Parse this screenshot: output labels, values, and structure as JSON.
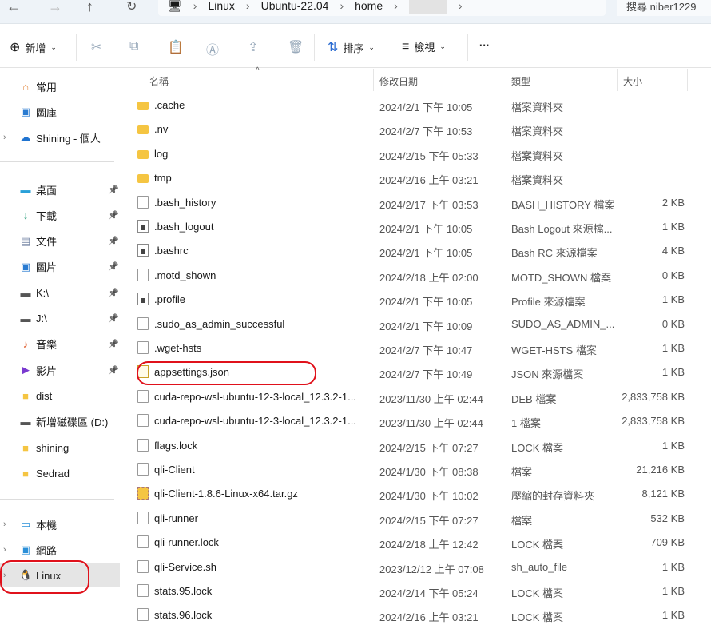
{
  "address": {
    "segments": [
      "Linux",
      "Ubuntu-22.04",
      "home"
    ],
    "search_placeholder": "搜尋 niber1229"
  },
  "toolbar": {
    "new": "新增",
    "sort": "排序",
    "view": "檢視",
    "more": "···"
  },
  "sidebar": {
    "top": [
      {
        "label": "常用",
        "icon": "home-icon"
      },
      {
        "label": "圖庫",
        "icon": "gallery-icon"
      },
      {
        "label": "Shining - 個人",
        "icon": "onedrive-icon"
      }
    ],
    "pinned": [
      {
        "label": "桌面",
        "icon": "desktop-icon"
      },
      {
        "label": "下載",
        "icon": "download-icon"
      },
      {
        "label": "文件",
        "icon": "documents-icon"
      },
      {
        "label": "圖片",
        "icon": "pictures-icon"
      },
      {
        "label": "K:\\",
        "icon": "network-drive-icon"
      },
      {
        "label": "J:\\",
        "icon": "network-drive-icon"
      },
      {
        "label": "音樂",
        "icon": "music-icon"
      },
      {
        "label": "影片",
        "icon": "video-icon"
      },
      {
        "label": "dist",
        "icon": "folder-icon"
      },
      {
        "label": "新增磁碟區 (D:)",
        "icon": "drive-icon"
      },
      {
        "label": "shining",
        "icon": "folder-icon"
      },
      {
        "label": "Sedrad",
        "icon": "folder-icon"
      }
    ],
    "bottom": [
      {
        "label": "本機",
        "icon": "pc-icon"
      },
      {
        "label": "網路",
        "icon": "network-icon"
      },
      {
        "label": "Linux",
        "icon": "linux-icon",
        "selected": true
      }
    ]
  },
  "columns": {
    "name": "名稱",
    "date": "修改日期",
    "type": "類型",
    "size": "大小"
  },
  "files": [
    {
      "name": ".cache",
      "date": "2024/2/1 下午 10:05",
      "type": "檔案資料夾",
      "size": "",
      "kind": "folder"
    },
    {
      "name": ".nv",
      "date": "2024/2/7 下午 10:53",
      "type": "檔案資料夾",
      "size": "",
      "kind": "folder"
    },
    {
      "name": "log",
      "date": "2024/2/15 下午 05:33",
      "type": "檔案資料夾",
      "size": "",
      "kind": "folder"
    },
    {
      "name": "tmp",
      "date": "2024/2/16 上午 03:21",
      "type": "檔案資料夾",
      "size": "",
      "kind": "folder"
    },
    {
      "name": ".bash_history",
      "date": "2024/2/17 下午 03:53",
      "type": "BASH_HISTORY 檔案",
      "size": "2 KB",
      "kind": "file"
    },
    {
      "name": ".bash_logout",
      "date": "2024/2/1 下午 10:05",
      "type": "Bash Logout 來源檔...",
      "size": "1 KB",
      "kind": "fileb"
    },
    {
      "name": ".bashrc",
      "date": "2024/2/1 下午 10:05",
      "type": "Bash RC 來源檔案",
      "size": "4 KB",
      "kind": "fileb"
    },
    {
      "name": ".motd_shown",
      "date": "2024/2/18 上午 02:00",
      "type": "MOTD_SHOWN 檔案",
      "size": "0 KB",
      "kind": "file"
    },
    {
      "name": ".profile",
      "date": "2024/2/1 下午 10:05",
      "type": "Profile 來源檔案",
      "size": "1 KB",
      "kind": "fileb"
    },
    {
      "name": ".sudo_as_admin_successful",
      "date": "2024/2/1 下午 10:09",
      "type": "SUDO_AS_ADMIN_...",
      "size": "0 KB",
      "kind": "file"
    },
    {
      "name": ".wget-hsts",
      "date": "2024/2/7 下午 10:47",
      "type": "WGET-HSTS 檔案",
      "size": "1 KB",
      "kind": "file"
    },
    {
      "name": "appsettings.json",
      "date": "2024/2/7 下午 10:49",
      "type": "JSON 來源檔案",
      "size": "1 KB",
      "kind": "json",
      "highlighted": true
    },
    {
      "name": "cuda-repo-wsl-ubuntu-12-3-local_12.3.2-1...",
      "date": "2023/11/30 上午 02:44",
      "type": "DEB 檔案",
      "size": "2,833,758 KB",
      "kind": "file"
    },
    {
      "name": "cuda-repo-wsl-ubuntu-12-3-local_12.3.2-1...",
      "date": "2023/11/30 上午 02:44",
      "type": "1 檔案",
      "size": "2,833,758 KB",
      "kind": "file"
    },
    {
      "name": "flags.lock",
      "date": "2024/2/15 下午 07:27",
      "type": "LOCK 檔案",
      "size": "1 KB",
      "kind": "file"
    },
    {
      "name": "qli-Client",
      "date": "2024/1/30 下午 08:38",
      "type": "檔案",
      "size": "21,216 KB",
      "kind": "file"
    },
    {
      "name": "qli-Client-1.8.6-Linux-x64.tar.gz",
      "date": "2024/1/30 下午 10:02",
      "type": "壓縮的封存資料夾",
      "size": "8,121 KB",
      "kind": "zip"
    },
    {
      "name": "qli-runner",
      "date": "2024/2/15 下午 07:27",
      "type": "檔案",
      "size": "532 KB",
      "kind": "file"
    },
    {
      "name": "qli-runner.lock",
      "date": "2024/2/18 上午 12:42",
      "type": "LOCK 檔案",
      "size": "709 KB",
      "kind": "file"
    },
    {
      "name": "qli-Service.sh",
      "date": "2023/12/12 上午 07:08",
      "type": "sh_auto_file",
      "size": "1 KB",
      "kind": "file"
    },
    {
      "name": "stats.95.lock",
      "date": "2024/2/14 下午 05:24",
      "type": "LOCK 檔案",
      "size": "1 KB",
      "kind": "file"
    },
    {
      "name": "stats.96.lock",
      "date": "2024/2/16 上午 03:21",
      "type": "LOCK 檔案",
      "size": "1 KB",
      "kind": "file"
    }
  ],
  "colors": {
    "annotation": "#e0111b",
    "folder": "#f5c542",
    "selected": "#e5e5e5"
  }
}
